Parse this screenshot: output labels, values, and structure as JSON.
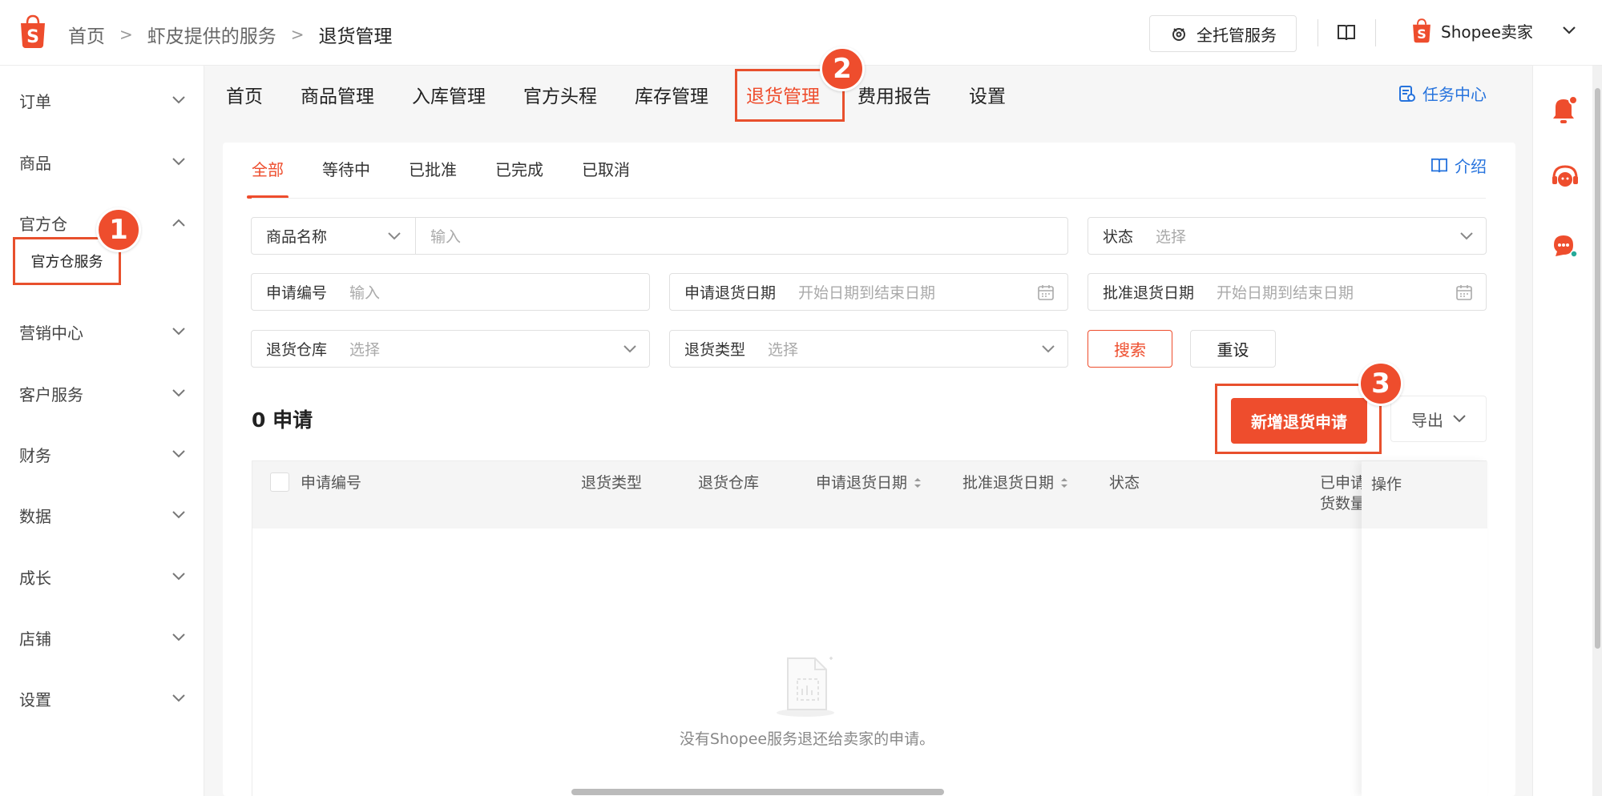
{
  "header": {
    "breadcrumb": [
      "首页",
      "虾皮提供的服务",
      "退货管理"
    ],
    "full_service_label": "全托管服务",
    "seller_label": "Shopee卖家"
  },
  "sidebar": {
    "items": [
      {
        "label": "订单"
      },
      {
        "label": "商品"
      },
      {
        "label": "官方仓"
      },
      {
        "label": "营销中心"
      },
      {
        "label": "客户服务"
      },
      {
        "label": "财务"
      },
      {
        "label": "数据"
      },
      {
        "label": "成长"
      },
      {
        "label": "店铺"
      },
      {
        "label": "设置"
      }
    ],
    "sub_item": "官方仓服务"
  },
  "badges": [
    "1",
    "2",
    "3"
  ],
  "topnav": {
    "items": [
      "首页",
      "商品管理",
      "入库管理",
      "官方头程",
      "库存管理",
      "退货管理",
      "费用报告",
      "设置"
    ],
    "active": "退货管理",
    "task_center": "任务中心"
  },
  "subtabs": {
    "items": [
      "全部",
      "等待中",
      "已批准",
      "已完成",
      "已取消"
    ],
    "active": "全部",
    "intro": "介绍"
  },
  "filters": {
    "product_name_label": "商品名称",
    "product_name_placeholder": "输入",
    "status_label": "状态",
    "status_placeholder": "选择",
    "request_no_label": "申请编号",
    "request_no_placeholder": "输入",
    "request_date_label": "申请退货日期",
    "request_date_placeholder": "开始日期到结束日期",
    "approve_date_label": "批准退货日期",
    "approve_date_placeholder": "开始日期到结束日期",
    "warehouse_label": "退货仓库",
    "warehouse_placeholder": "选择",
    "type_label": "退货类型",
    "type_placeholder": "选择",
    "search_label": "搜索",
    "reset_label": "重设"
  },
  "results": {
    "count_label": "0 申请",
    "new_request_label": "新增退货申请",
    "export_label": "导出"
  },
  "table": {
    "columns": [
      "申请编号",
      "退货类型",
      "退货仓库",
      "申请退货日期",
      "批准退货日期",
      "状态",
      "已申请退\n货数量",
      "操作"
    ],
    "empty_text": "没有Shopee服务退还给卖家的申请。"
  },
  "colors": {
    "brand": "#ee4d2d",
    "link": "#2673dd"
  }
}
